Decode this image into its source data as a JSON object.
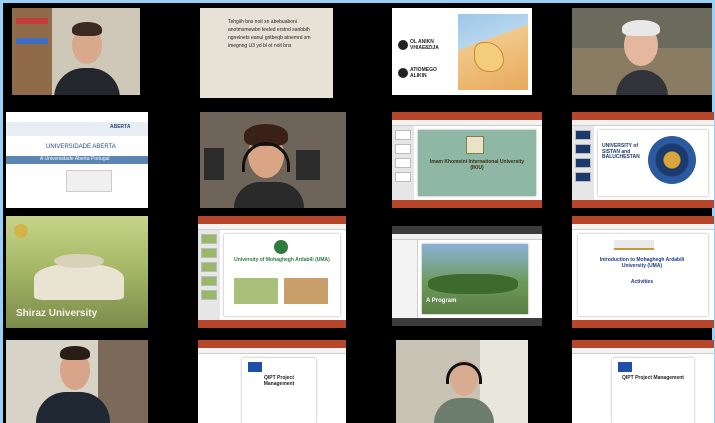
{
  "colors": {
    "frame_edge": "#9ad0f5",
    "background": "#000000",
    "ppt_accent": "#b7472a"
  },
  "tiles": {
    "t1": {
      "kind": "video"
    },
    "t2": {
      "kind": "slide",
      "lines": [
        "Tehgiih bns noit sn abebuaboni",
        "anotmsmewbn teeled erstnd sanbbih",
        "ngnelnets eanul gritbeqb atnemrd sm",
        "imegnng U3 yd bl ot noit bns"
      ]
    },
    "t3": {
      "kind": "slide",
      "logo_top": "OL ANIKN VHIAE8ZIJA",
      "logo_bottom": "ATIOMEGO ALIKIN"
    },
    "t4": {
      "kind": "video"
    },
    "t5": {
      "kind": "slide",
      "title": "UNIVERSIDADE ABERTA",
      "logo": "ABERTA",
      "subtitle": "A Universidade Aberta Portugal"
    },
    "t6": {
      "kind": "video"
    },
    "t7": {
      "kind": "slide",
      "title": "Imam Khomeini International University (IKIU)"
    },
    "t8": {
      "kind": "slide",
      "title": "UNIVERSITY of SISTAN and BALUCHESTAN"
    },
    "t9": {
      "kind": "image",
      "caption": "Shiraz University"
    },
    "t10": {
      "kind": "slide",
      "title": "University of Mohaghegh Ardabili (UMA)"
    },
    "t11": {
      "kind": "slide",
      "title": "A Program"
    },
    "t12": {
      "kind": "slide",
      "title": "Introduction to Mohaghegh Ardabili University (UMA)",
      "subtitle": "Activities"
    },
    "t13": {
      "kind": "video"
    },
    "t14": {
      "kind": "slide",
      "title": "QIPT Project Management"
    },
    "t15": {
      "kind": "video"
    },
    "t16": {
      "kind": "slide",
      "title": "QIPT Project Management"
    }
  }
}
